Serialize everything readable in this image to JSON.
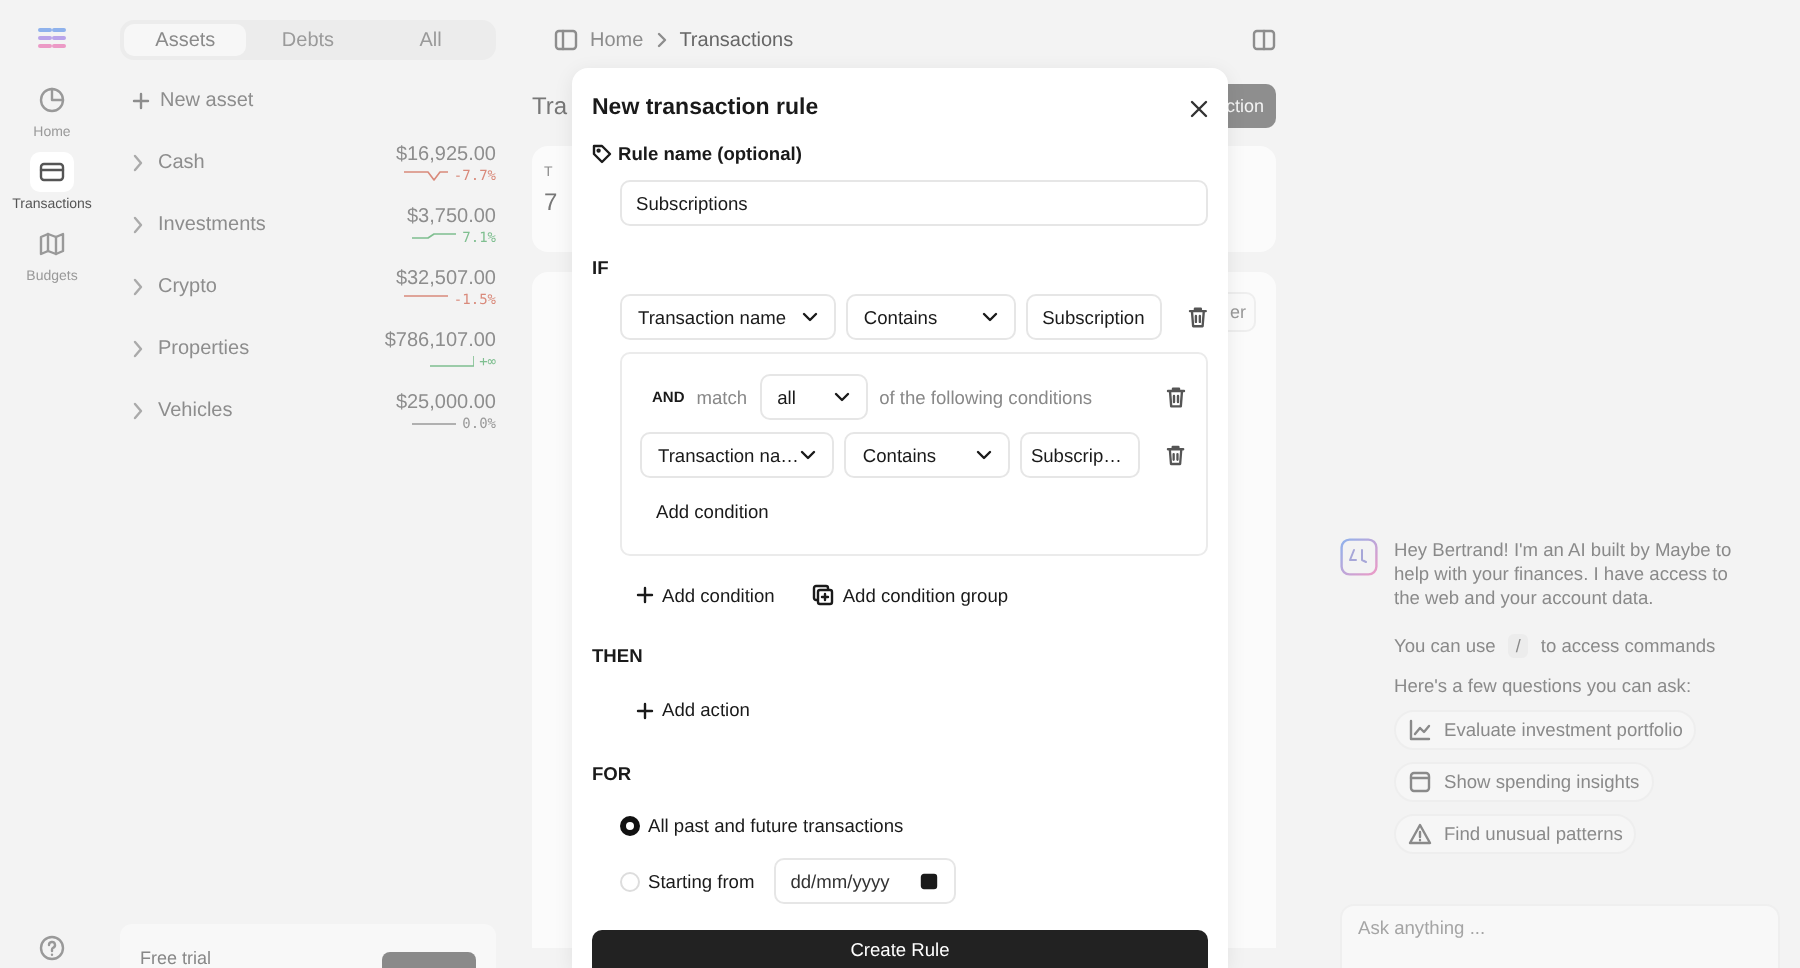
{
  "nav": {
    "items": [
      {
        "label": "Home",
        "selected": false
      },
      {
        "label": "Transactions",
        "selected": true
      },
      {
        "label": "Budgets",
        "selected": false
      }
    ]
  },
  "sidebar": {
    "tabs": [
      {
        "label": "Assets",
        "selected": true
      },
      {
        "label": "Debts",
        "selected": false
      },
      {
        "label": "All",
        "selected": false
      }
    ],
    "new_asset": "New asset",
    "accounts": [
      {
        "name": "Cash",
        "value": "$16,925.00",
        "change": "-7.7%"
      },
      {
        "name": "Investments",
        "value": "$3,750.00",
        "change": "7.1%"
      },
      {
        "name": "Crypto",
        "value": "$32,507.00",
        "change": "-1.5%"
      },
      {
        "name": "Properties",
        "value": "$786,107.00",
        "change": "+∞"
      },
      {
        "name": "Vehicles",
        "value": "$25,000.00",
        "change": "0.0%"
      }
    ],
    "trial": {
      "title": "Free trial"
    }
  },
  "main": {
    "breadcrumb": [
      "Home",
      "Transactions"
    ],
    "title": "Tra",
    "action": "ction",
    "summary_label": "T",
    "summary_value": "7",
    "filter": "er"
  },
  "modal": {
    "title": "New transaction rule",
    "name_label": "Rule name (optional)",
    "name_value": "Subscriptions",
    "if_label": "IF",
    "condition": {
      "field": "Transaction name",
      "operator": "Contains",
      "value": "Subscription"
    },
    "group": {
      "conjunction": "AND",
      "match_label": "match",
      "match_value": "all",
      "match_suffix": "of the following conditions",
      "conditions": [
        {
          "field": "Transaction na…",
          "operator": "Contains",
          "value": "Subscrip…"
        }
      ],
      "add_condition": "Add condition"
    },
    "add_condition": "Add condition",
    "add_group": "Add condition group",
    "then_label": "THEN",
    "add_action": "Add action",
    "for_label": "FOR",
    "scope_options": [
      {
        "kind": "all",
        "label": "All past and future transactions",
        "selected": true
      },
      {
        "kind": "date",
        "label": "Starting from",
        "selected": false,
        "placeholder": "dd/mm/yyyy"
      }
    ],
    "submit": "Create Rule"
  },
  "chat": {
    "greeting": "Hey Bertrand! I'm an AI built by Maybe to help with your finances. I have access to the web and your account data.",
    "commands_before": "You can use",
    "commands_key": "/",
    "commands_after": "to access commands",
    "prompt": "Here's a few questions you can ask:",
    "suggestions": [
      {
        "label": "Evaluate investment portfolio"
      },
      {
        "label": "Show spending insights"
      },
      {
        "label": "Find unusual patterns"
      }
    ],
    "placeholder": "Ask anything ..."
  }
}
